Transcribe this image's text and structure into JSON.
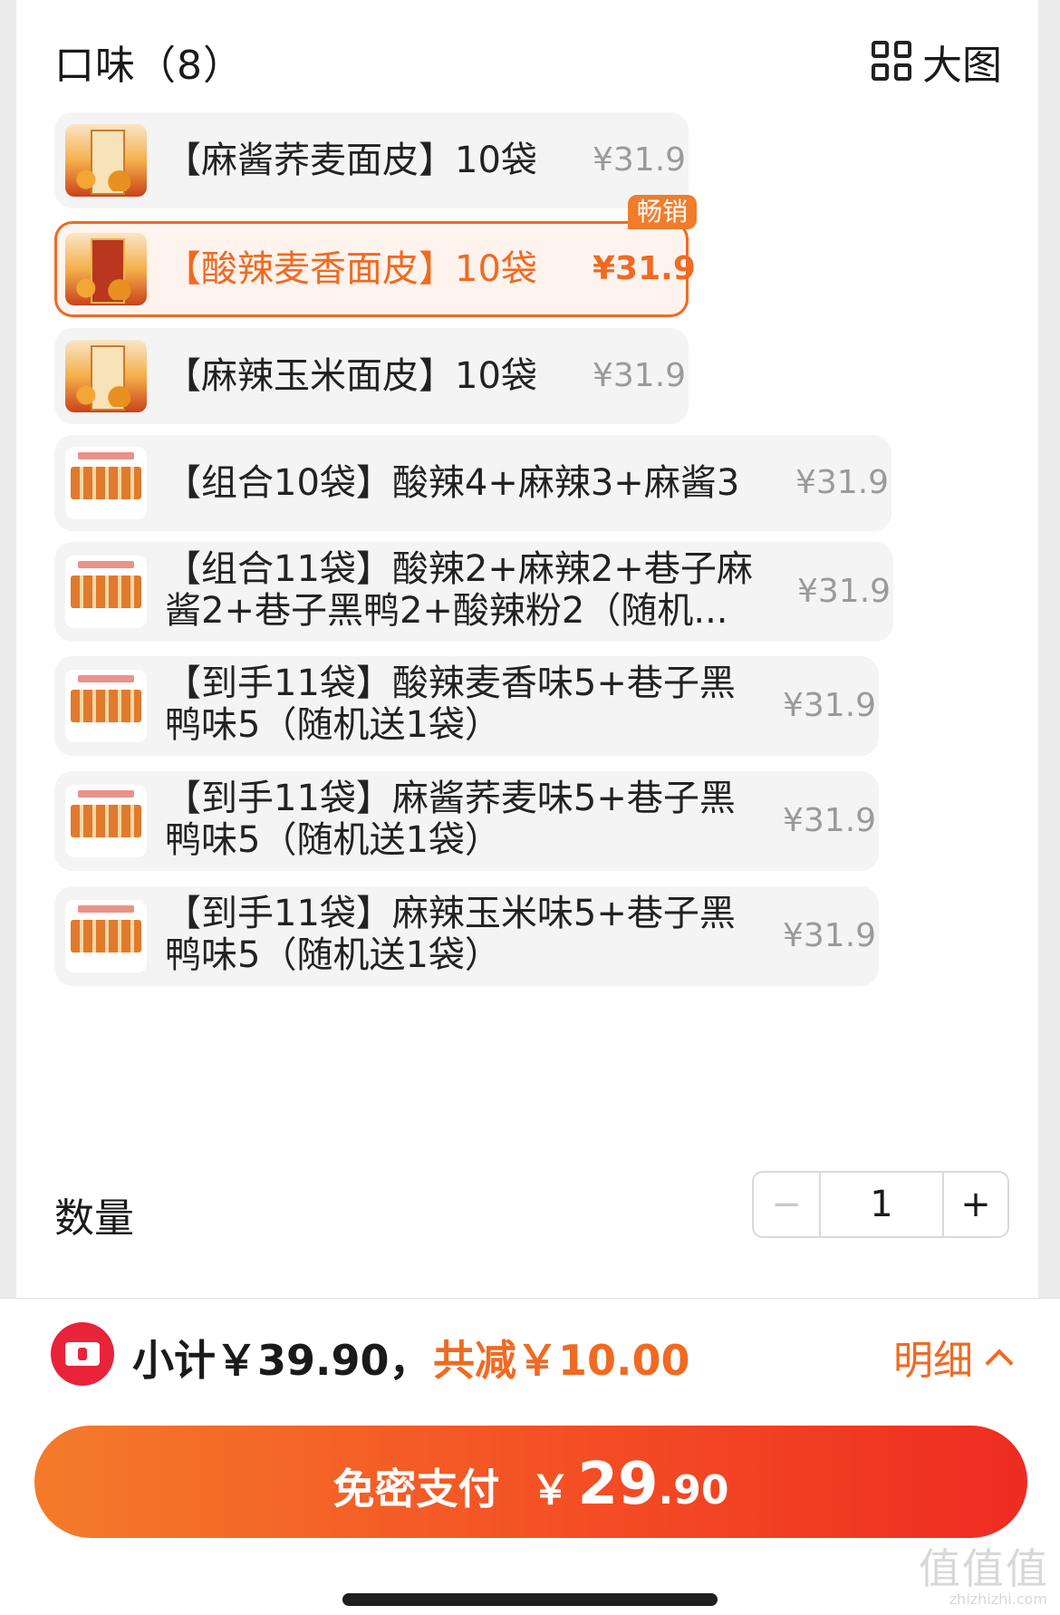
{
  "header": {
    "title": "口味（8）",
    "view_toggle": "大图",
    "view_toggle_icon": "grid-icon"
  },
  "options": [
    {
      "label": "【麻酱荞麦面皮】10袋",
      "price": "¥31.9",
      "selected": false,
      "thumb": "product-bag"
    },
    {
      "label": "【酸辣麦香面皮】10袋",
      "price": "¥31.9",
      "selected": true,
      "badge": "畅销",
      "thumb": "product-bag"
    },
    {
      "label": "【麻辣玉米面皮】10袋",
      "price": "¥31.9",
      "selected": false,
      "thumb": "product-bag"
    },
    {
      "label": "【组合10袋】酸辣4+麻辣3+麻酱3",
      "price": "¥31.9",
      "selected": false,
      "thumb": "combo-pack"
    },
    {
      "line1": "【组合11袋】酸辣2+麻辣2+巷子麻",
      "line2": "酱2+巷子黑鸭2+酸辣粉2（随机...",
      "price": "¥31.9",
      "selected": false,
      "thumb": "combo-pack"
    },
    {
      "line1": "【到手11袋】酸辣麦香味5+巷子黑",
      "line2": "鸭味5（随机送1袋）",
      "price": "¥31.9",
      "selected": false,
      "thumb": "combo-pack"
    },
    {
      "line1": "【到手11袋】麻酱荞麦味5+巷子黑",
      "line2": "鸭味5（随机送1袋）",
      "price": "¥31.9",
      "selected": false,
      "thumb": "combo-pack"
    },
    {
      "line1": "【到手11袋】麻辣玉米味5+巷子黑",
      "line2": "鸭味5（随机送1袋）",
      "price": "¥31.9",
      "selected": false,
      "thumb": "combo-pack"
    }
  ],
  "quantity": {
    "label": "数量",
    "minus": "−",
    "value": "1",
    "plus": "+"
  },
  "footer": {
    "subtotal": "小计￥39.90，",
    "discount": "共减￥10.00",
    "detail": "明细",
    "pay_button": {
      "label": "免密支付",
      "currency": "￥",
      "amount_int": "29",
      "amount_dec": ".90"
    }
  },
  "watermark": {
    "mark": "值值值",
    "url": "zhizhizhi.com"
  },
  "colors": {
    "accent": "#f06a22",
    "coupon": "#e8233a",
    "price_gray": "#9a9a9a"
  }
}
